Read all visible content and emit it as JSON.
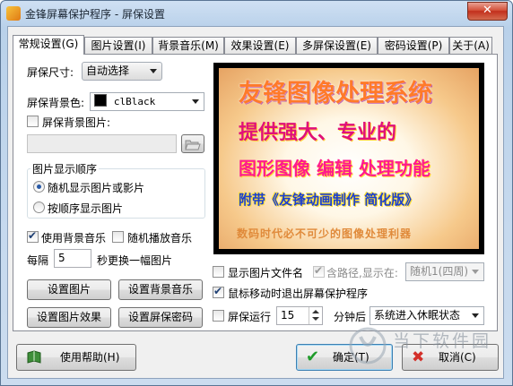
{
  "window": {
    "title": "金锋屏幕保护程序 - 屏保设置",
    "close_label": "✕"
  },
  "tabs": [
    {
      "label": "常规设置(G)",
      "active": true
    },
    {
      "label": "图片设置(I)",
      "active": false
    },
    {
      "label": "背景音乐(M)",
      "active": false
    },
    {
      "label": "效果设置(E)",
      "active": false
    },
    {
      "label": "多屏保设置(E)",
      "active": false
    },
    {
      "label": "密码设置(P)",
      "active": false
    },
    {
      "label": "关于(A)",
      "active": false
    }
  ],
  "general": {
    "size_label": "屏保尺寸:",
    "size_value": "自动选择",
    "bg_color_label": "屏保背景色:",
    "bg_color_value": "clBlack",
    "bg_color_swatch": "#000000",
    "bg_image_label": "屏保背景图片:",
    "bg_image_checked": false,
    "bg_image_path": "",
    "order_group_title": "图片显示顺序",
    "order_random_label": "随机显示图片或影片",
    "order_random_selected": true,
    "order_sequential_label": "按顺序显示图片",
    "order_sequential_selected": false,
    "use_music_label": "使用背景音乐",
    "use_music_checked": true,
    "random_music_label": "随机播放音乐",
    "random_music_checked": false,
    "interval_prefix": "每隔",
    "interval_value": "5",
    "interval_suffix": "秒更换一幅图片",
    "buttons": {
      "set_images": "设置图片",
      "set_music": "设置背景音乐",
      "set_effects": "设置图片效果",
      "set_password": "设置屏保密码"
    }
  },
  "preview": {
    "line1": "友锋图像处理系统",
    "line2": "提供强大、专业的",
    "line3": "图形图像 编辑 处理功能",
    "line4": "附带《友锋动画制作 简化版》",
    "line5": "数码时代必不可少的图像处理利器"
  },
  "options": {
    "show_filename_label": "显示图片文件名",
    "show_filename_checked": false,
    "include_path_label": "含路径,显示在:",
    "include_path_checked": true,
    "include_path_enabled": false,
    "display_position": "随机1(四周)",
    "exit_on_mouse_label": "鼠标移动时退出屏幕保护程序",
    "exit_on_mouse_checked": true,
    "run_label": "屏保运行",
    "run_checked": false,
    "run_minutes": "15",
    "run_minutes_suffix": "分钟后",
    "run_action": "系统进入休眠状态"
  },
  "footer": {
    "help_label": "使用帮助(H)",
    "ok_label": "确定(T)",
    "cancel_label": "取消(C)"
  },
  "watermark": {
    "text": "当下软件园"
  },
  "colors": {
    "accent": "#2a5aa6",
    "ok_icon": "#1f9b2a",
    "cancel_icon": "#d3302a"
  }
}
